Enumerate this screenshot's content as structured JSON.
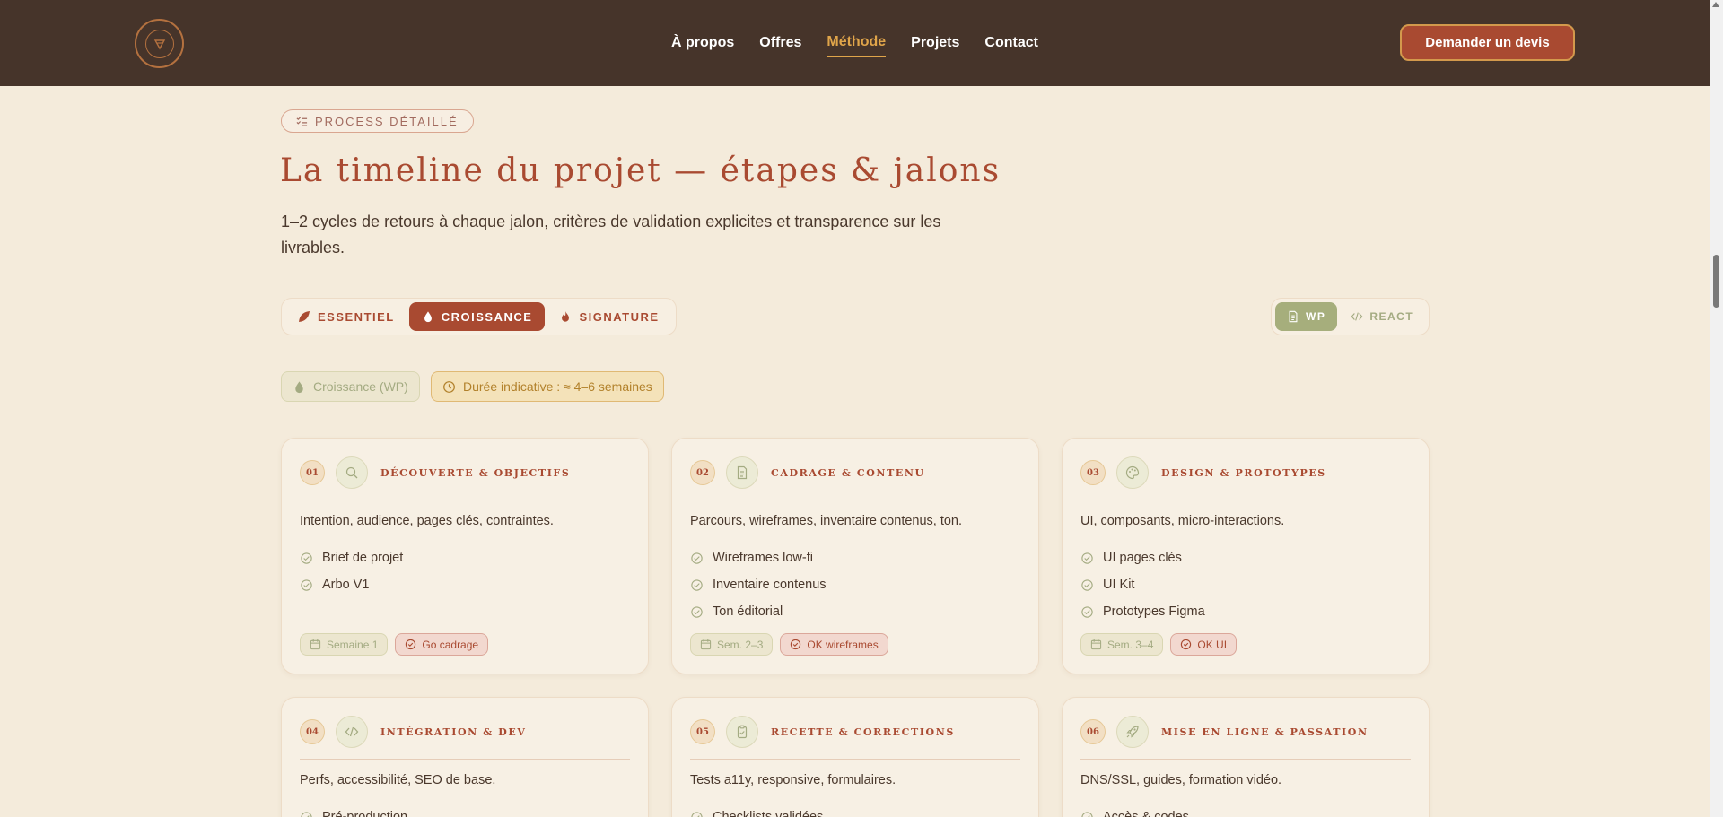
{
  "header": {
    "nav": [
      "À propos",
      "Offres",
      "Méthode",
      "Projets",
      "Contact"
    ],
    "active_nav": "Méthode",
    "cta_label": "Demander un devis"
  },
  "section": {
    "kicker": "PROCESS DÉTAILLÉ",
    "title": "La timeline du projet — étapes & jalons",
    "lead": "1–2 cycles de retours à chaque jalon, critères de validation explicites et transparence sur les livrables."
  },
  "plans": [
    {
      "label": "ESSENTIEL",
      "icon": "leaf-icon",
      "active": false
    },
    {
      "label": "CROISSANCE",
      "icon": "drop-icon",
      "active": true
    },
    {
      "label": "SIGNATURE",
      "icon": "flame-icon",
      "active": false
    }
  ],
  "tech": [
    {
      "label": "WP",
      "icon": "file-icon",
      "active": true
    },
    {
      "label": "REACT",
      "icon": "code-icon",
      "active": false
    }
  ],
  "chips": {
    "plan": "Croissance (WP)",
    "duration": "Durée indicative : ≈ 4–6 semaines"
  },
  "steps": [
    {
      "num": "01",
      "icon": "search-icon",
      "title": "Découverte & objectifs",
      "desc": "Intention, audience, pages clés, contraintes.",
      "items": [
        "Brief de projet",
        "Arbo V1"
      ],
      "week": "Semaine 1",
      "milestone": "Go cadrage"
    },
    {
      "num": "02",
      "icon": "document-icon",
      "title": "Cadrage & contenu",
      "desc": "Parcours, wireframes, inventaire contenus, ton.",
      "items": [
        "Wireframes low-fi",
        "Inventaire contenus",
        "Ton éditorial"
      ],
      "week": "Sem. 2–3",
      "milestone": "OK wireframes"
    },
    {
      "num": "03",
      "icon": "palette-icon",
      "title": "Design & prototypes",
      "desc": "UI, composants, micro-interactions.",
      "items": [
        "UI pages clés",
        "UI Kit",
        "Prototypes Figma"
      ],
      "week": "Sem. 3–4",
      "milestone": "OK UI"
    },
    {
      "num": "04",
      "icon": "code-icon",
      "title": "Intégration & dev",
      "desc": "Perfs, accessibilité, SEO de base.",
      "items": [
        "Pré-production"
      ]
    },
    {
      "num": "05",
      "icon": "clipboard-icon",
      "title": "Recette & corrections",
      "desc": "Tests a11y, responsive, formulaires.",
      "items": [
        "Checklists validées"
      ]
    },
    {
      "num": "06",
      "icon": "rocket-icon",
      "title": "Mise en ligne & passation",
      "desc": "DNS/SSL, guides, formation vidéo.",
      "items": [
        "Accès & codes"
      ]
    }
  ],
  "colors": {
    "header_bg": "#46342a",
    "page_bg": "#f4ebdb",
    "accent": "#a94a31",
    "gold": "#e0a54a",
    "sage": "#a6ae7c"
  }
}
